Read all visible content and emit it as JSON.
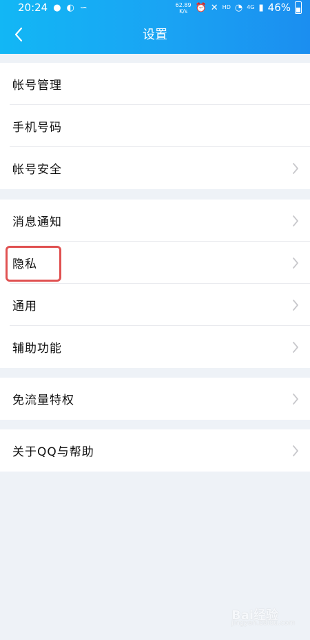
{
  "status_bar": {
    "time": "20:24",
    "speed_value": "62.89",
    "speed_unit": "K/s",
    "hd": "HD",
    "signal_4g": "4G",
    "battery": "46%"
  },
  "header": {
    "title": "设置",
    "back_icon": "chevron-left-icon"
  },
  "sections": [
    {
      "items": [
        {
          "label": "帐号管理"
        },
        {
          "label": "手机号码"
        },
        {
          "label": "帐号安全"
        }
      ]
    },
    {
      "items": [
        {
          "label": "消息通知"
        },
        {
          "label": "隐私"
        },
        {
          "label": "通用"
        },
        {
          "label": "辅助功能"
        }
      ]
    },
    {
      "items": [
        {
          "label": "免流量特权"
        }
      ]
    },
    {
      "items": [
        {
          "label": "关于QQ与帮助"
        }
      ]
    }
  ],
  "highlight": {
    "color": "#e05151",
    "target": "隐私"
  },
  "watermark": {
    "main": "Bai经验",
    "sub": "jingyan.baidu.com"
  }
}
